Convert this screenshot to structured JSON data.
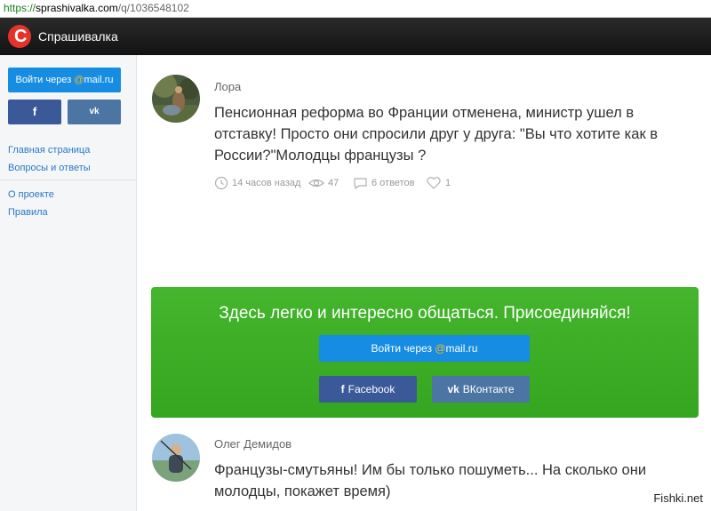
{
  "browser": {
    "url_scheme": "https://",
    "url_host": "sprashivalka.com",
    "url_path": "/q/1036548102"
  },
  "site": {
    "logo_letter": "С",
    "name": "Спрашивалка",
    "brand_color": "#e6332a"
  },
  "sidebar": {
    "mail_login_prefix": "Войти через ",
    "mail_at": "@",
    "mail_domain": "mail.ru",
    "fb_label": "f",
    "vk_label": "vk",
    "nav": [
      {
        "label": "Главная страница"
      },
      {
        "label": "Вопросы и ответы"
      },
      {
        "label": "О проекте"
      },
      {
        "label": "Правила"
      }
    ]
  },
  "question": {
    "author": "Лора",
    "text": "Пенсионная реформа во Франции отменена, министр ушел в отставку! Просто они спросили друг у друга: \"Вы что хотите как в России?\"Молодцы французы ?",
    "time": "14 часов назад",
    "views": "47",
    "answers": "6 ответов",
    "likes": "1"
  },
  "banner": {
    "title": "Здесь легко и интересно общаться. Присоединяйся!",
    "mail_login_prefix": "Войти через ",
    "mail_at": "@",
    "mail_domain": "mail.ru",
    "fb_icon": "f",
    "fb_label": "Facebook",
    "vk_icon": "vk",
    "vk_label": "ВКонтакте",
    "color": "#3aad24"
  },
  "answer": {
    "author": "Олег Демидов",
    "text": "Французы-смутьяны! Им бы только пошуметь... На сколько они молодцы, покажет время)"
  },
  "watermark": "Fishki.net"
}
